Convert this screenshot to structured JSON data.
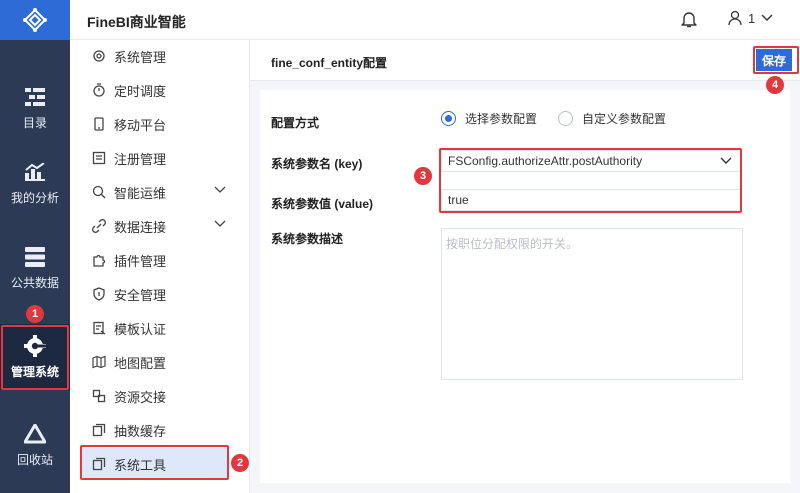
{
  "app": {
    "title": "FineBI商业智能"
  },
  "header": {
    "user_label": "1"
  },
  "rail": {
    "items": [
      {
        "label": "目录",
        "icon": "directory-icon"
      },
      {
        "label": "我的分析",
        "icon": "analysis-icon"
      },
      {
        "label": "公共数据",
        "icon": "public-data-icon"
      },
      {
        "label": "管理系统",
        "icon": "management-icon",
        "active": true
      },
      {
        "label": "回收站",
        "icon": "recycle-bin-icon"
      }
    ]
  },
  "submenu": {
    "items": [
      {
        "label": "系统管理",
        "icon": "gear-icon"
      },
      {
        "label": "定时调度",
        "icon": "timer-icon"
      },
      {
        "label": "移动平台",
        "icon": "mobile-icon"
      },
      {
        "label": "注册管理",
        "icon": "register-icon"
      },
      {
        "label": "智能运维",
        "icon": "ops-icon",
        "expandable": true
      },
      {
        "label": "数据连接",
        "icon": "link-icon",
        "expandable": true
      },
      {
        "label": "插件管理",
        "icon": "plugin-icon"
      },
      {
        "label": "安全管理",
        "icon": "shield-icon"
      },
      {
        "label": "模板认证",
        "icon": "template-icon"
      },
      {
        "label": "地图配置",
        "icon": "map-icon"
      },
      {
        "label": "资源交接",
        "icon": "transfer-icon"
      },
      {
        "label": "抽数缓存",
        "icon": "cache-icon"
      },
      {
        "label": "系统工具",
        "icon": "tool-icon",
        "active": true
      }
    ]
  },
  "main": {
    "entity_title": "fine_conf_entity配置",
    "save_label": "保存",
    "form": {
      "config_mode_label": "配置方式",
      "options": [
        "选择参数配置",
        "自定义参数配置"
      ],
      "selected_option": "选择参数配置",
      "param_name_label": "系统参数名 (key)",
      "param_name_value": "FSConfig.authorizeAttr.postAuthority",
      "param_value_label": "系统参数值 (value)",
      "param_value": "true",
      "param_desc_label": "系统参数描述",
      "param_desc_placeholder": "按职位分配权限的开关。"
    }
  },
  "annotations": [
    "1",
    "2",
    "3",
    "4"
  ],
  "colors": {
    "accent": "#2e6bd6",
    "rail_bg": "#2c3a55",
    "highlight": "#e0383e",
    "active_menu_bg": "#dfe8fb"
  }
}
